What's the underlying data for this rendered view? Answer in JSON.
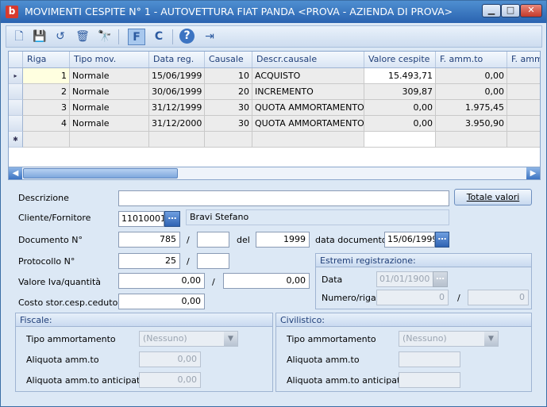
{
  "window": {
    "title": "MOVIMENTI CESPITE N° 1 - AUTOVETTURA FIAT PANDA <PROVA - AZIENDA DI PROVA>",
    "app_icon": "b",
    "min_icon": "▁",
    "max_icon": "□",
    "close_icon": "✕"
  },
  "toolbar": {
    "new_icon": "🗋",
    "save_icon": "💾",
    "undo_icon": "↺",
    "delete_icon": "🗑",
    "find_icon": "🔭",
    "filter_f": "F",
    "filter_c": "C",
    "help_icon": "?",
    "exit_icon": "⇥"
  },
  "grid": {
    "columns": [
      "Riga",
      "Tipo mov.",
      "Data reg.",
      "Causale",
      "Descr.causale",
      "Valore cespite",
      "F. amm.to",
      "F. amm..."
    ],
    "rows": [
      {
        "ind": "▸",
        "riga": "1",
        "tipo": "Normale",
        "data": "15/06/1999",
        "causale": "10",
        "descr": "ACQUISTO",
        "valore": "15.493,71",
        "famm": "0,00",
        "famm2": ""
      },
      {
        "ind": "",
        "riga": "2",
        "tipo": "Normale",
        "data": "30/06/1999",
        "causale": "20",
        "descr": "INCREMENTO",
        "valore": "309,87",
        "famm": "0,00",
        "famm2": ""
      },
      {
        "ind": "",
        "riga": "3",
        "tipo": "Normale",
        "data": "31/12/1999",
        "causale": "30",
        "descr": "QUOTA AMMORTAMENTO",
        "valore": "0,00",
        "famm": "1.975,45",
        "famm2": ""
      },
      {
        "ind": "",
        "riga": "4",
        "tipo": "Normale",
        "data": "31/12/2000",
        "causale": "30",
        "descr": "QUOTA AMMORTAMENTO",
        "valore": "0,00",
        "famm": "3.950,90",
        "famm2": ""
      }
    ],
    "new_row_marker": "✱",
    "scroll_left": "◀",
    "scroll_right": "▶"
  },
  "form": {
    "descrizione_label": "Descrizione",
    "descrizione_value": "",
    "totale_valori": "Totale valori",
    "cliente_label": "Cliente/Fornitore",
    "cliente_code": "11010001",
    "cliente_name": "Bravi Stefano",
    "documento_label": "Documento N°",
    "documento_num": "785",
    "documento_suffix": "",
    "del_label": "del",
    "documento_anno": "1999",
    "data_documento_label": "data documento",
    "data_documento": "15/06/1999",
    "protocollo_label": "Protocollo N°",
    "protocollo_num": "25",
    "protocollo_suffix": "",
    "slash": "/",
    "valore_iva_label": "Valore Iva/quantità",
    "valore_iva": "0,00",
    "quantita": "0,00",
    "costo_label": "Costo stor.cesp.ceduto",
    "costo_value": "0,00",
    "dots": "…"
  },
  "estremi": {
    "title": "Estremi registrazione:",
    "data_label": "Data",
    "data_value": "01/01/1900",
    "numero_label": "Numero/riga",
    "numero_value": "0",
    "riga_value": "0"
  },
  "fiscale": {
    "title": "Fiscale:",
    "tipo_label": "Tipo ammortamento",
    "tipo_value": "(Nessuno)",
    "aliquota_label": "Aliquota amm.to",
    "aliquota_value": "0,00",
    "anticipato_label": "Aliquota amm.to anticipato",
    "anticipato_value": "0,00"
  },
  "civilistico": {
    "title": "Civilistico:",
    "tipo_label": "Tipo ammortamento",
    "tipo_value": "(Nessuno)",
    "aliquota_label": "Aliquota amm.to",
    "aliquota_value": "",
    "anticipato_label": "Aliquota amm.to anticipato",
    "anticipato_value": ""
  },
  "colors": {
    "title_bar": "#2a63b0",
    "window_bg": "#dce8f5",
    "accent": "#3c74c2"
  }
}
